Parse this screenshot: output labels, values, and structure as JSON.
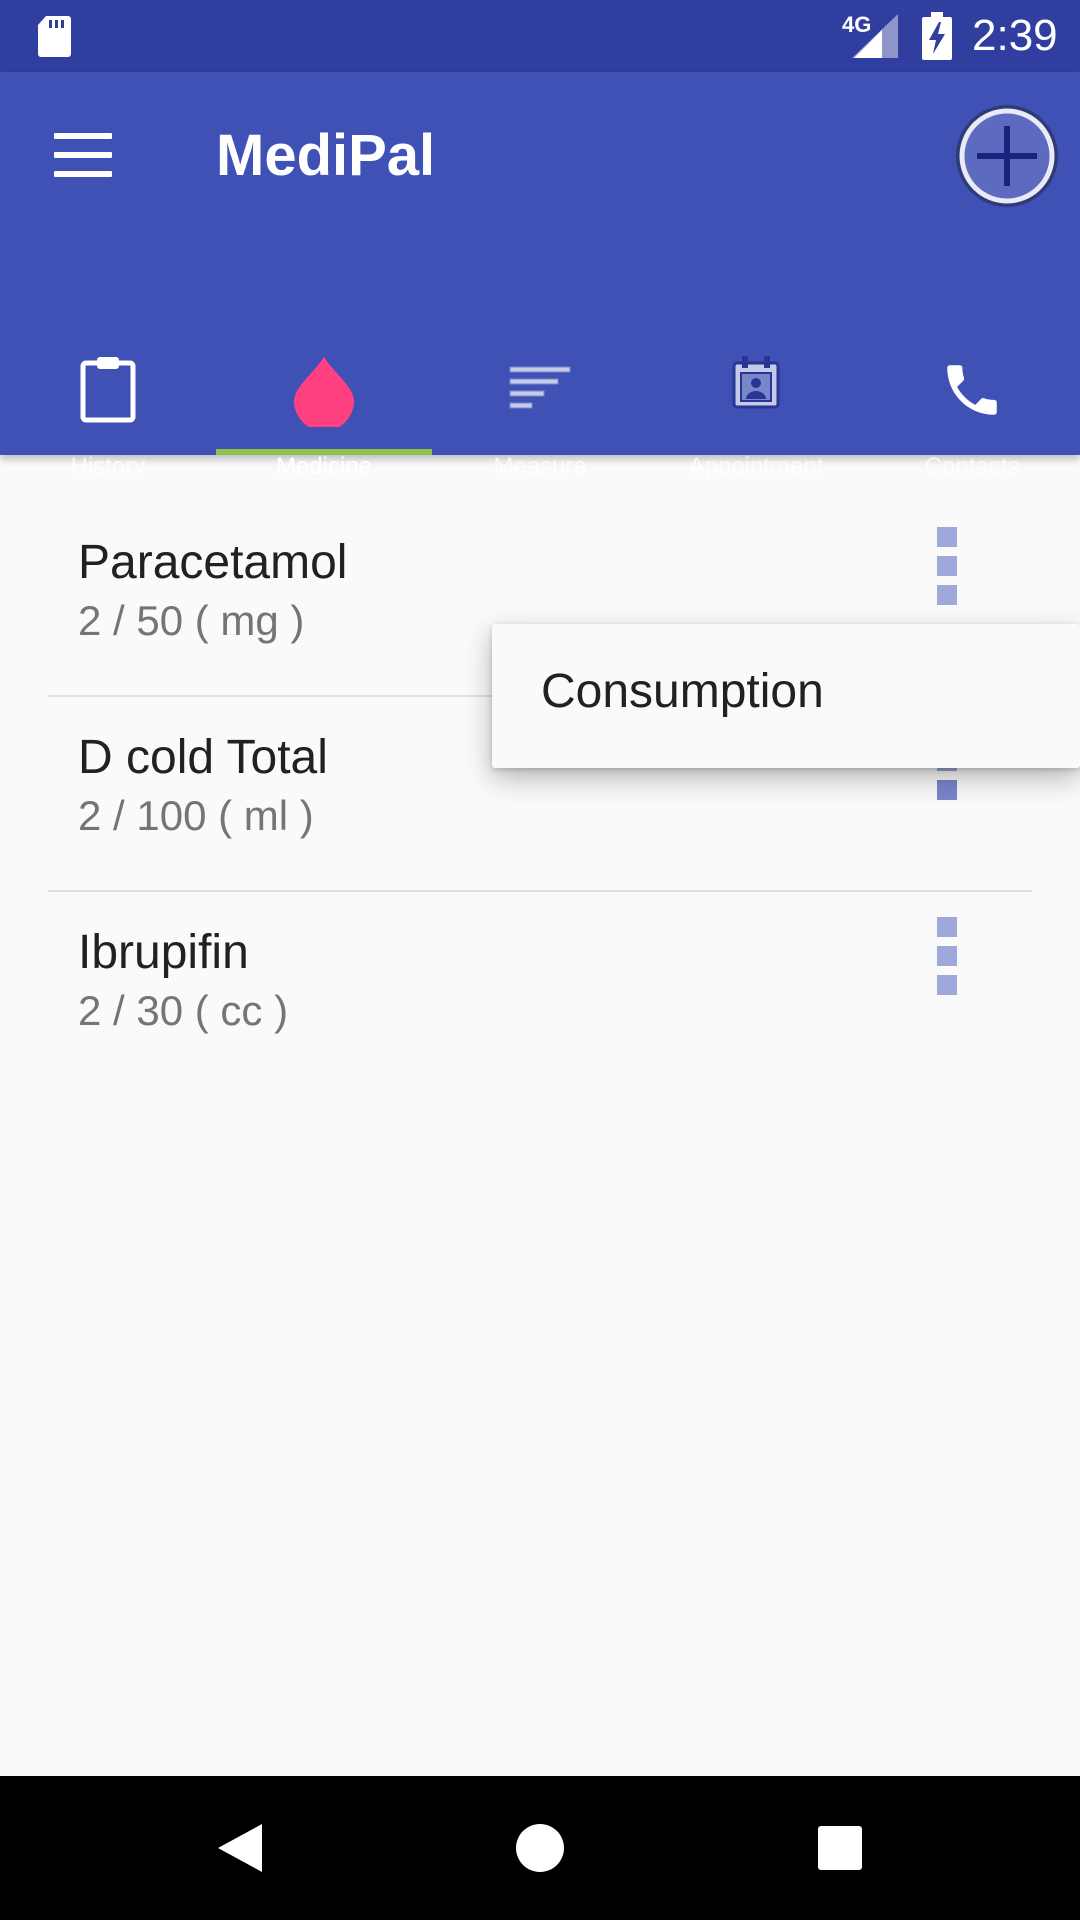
{
  "status_bar": {
    "network": "4G",
    "time": "2:39",
    "icons": [
      "sd-card-icon",
      "signal-icon",
      "battery-charging-icon"
    ]
  },
  "app_bar": {
    "title": "MediPal",
    "menu_icon": "hamburger-menu-icon",
    "add_icon": "add-circle-icon",
    "color": "#3f51b5",
    "status_color": "#303f9f"
  },
  "tabs": [
    {
      "label": "History",
      "icon": "clipboard-icon",
      "active": false
    },
    {
      "label": "Medicine",
      "icon": "drop-icon",
      "active": true
    },
    {
      "label": "Measure",
      "icon": "measure-lines-icon",
      "active": false
    },
    {
      "label": "Appointment",
      "icon": "calendar-contact-icon",
      "active": false
    },
    {
      "label": "Contacts",
      "icon": "phone-icon",
      "active": false
    }
  ],
  "tab_indicator_color": "#8bc34a",
  "accent_color": "#ff4081",
  "medicines": [
    {
      "name": "Paracetamol",
      "quantity": "2 / 50 ( mg )"
    },
    {
      "name": "D cold Total",
      "quantity": "2 / 100 ( ml )"
    },
    {
      "name": "Ibrupifin",
      "quantity": "2 / 30 ( cc )"
    }
  ],
  "popup_menu": {
    "items": [
      "Consumption"
    ]
  },
  "nav_bar": {
    "icons": [
      "back-icon",
      "home-icon",
      "recents-icon"
    ]
  }
}
